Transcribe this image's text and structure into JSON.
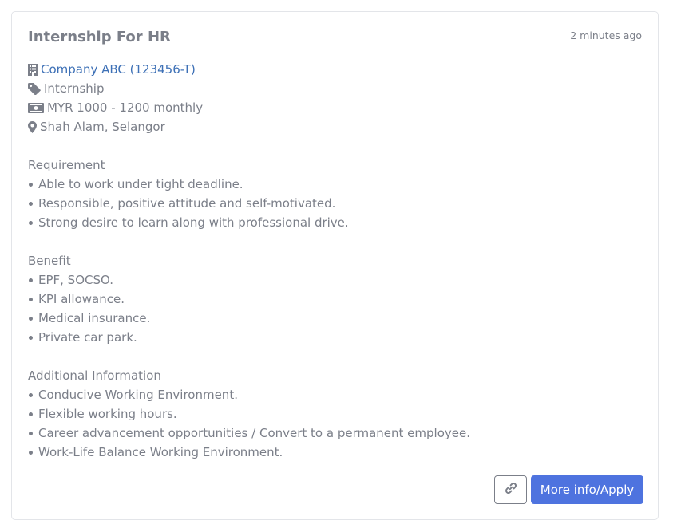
{
  "job": {
    "title": "Internship For HR",
    "posted": "2 minutes ago",
    "company": "Company ABC (123456-T)",
    "type": "Internship",
    "salary": "MYR 1000 - 1200 monthly",
    "location": "Shah Alam, Selangor"
  },
  "sections": {
    "requirement": {
      "title": "Requirement",
      "items": [
        "Able to work under tight deadline.",
        "Responsible, positive attitude and self-motivated.",
        "Strong desire to learn along with professional drive."
      ]
    },
    "benefit": {
      "title": "Benefit",
      "items": [
        "EPF, SOCSO.",
        "KPI allowance.",
        "Medical insurance.",
        "Private car park."
      ]
    },
    "additional": {
      "title": "Additional Information",
      "items": [
        "Conducive Working Environment.",
        "Flexible working hours.",
        "Career advancement opportunities / Convert to a permanent employee.",
        "Work-Life Balance Working Environment."
      ]
    }
  },
  "actions": {
    "apply_label": "More info/Apply",
    "link_icon": "link-icon"
  },
  "colors": {
    "text": "#7b7f89",
    "company_link": "#3d70b6",
    "primary_button": "#4e73df",
    "card_border": "#e3e5e9"
  }
}
